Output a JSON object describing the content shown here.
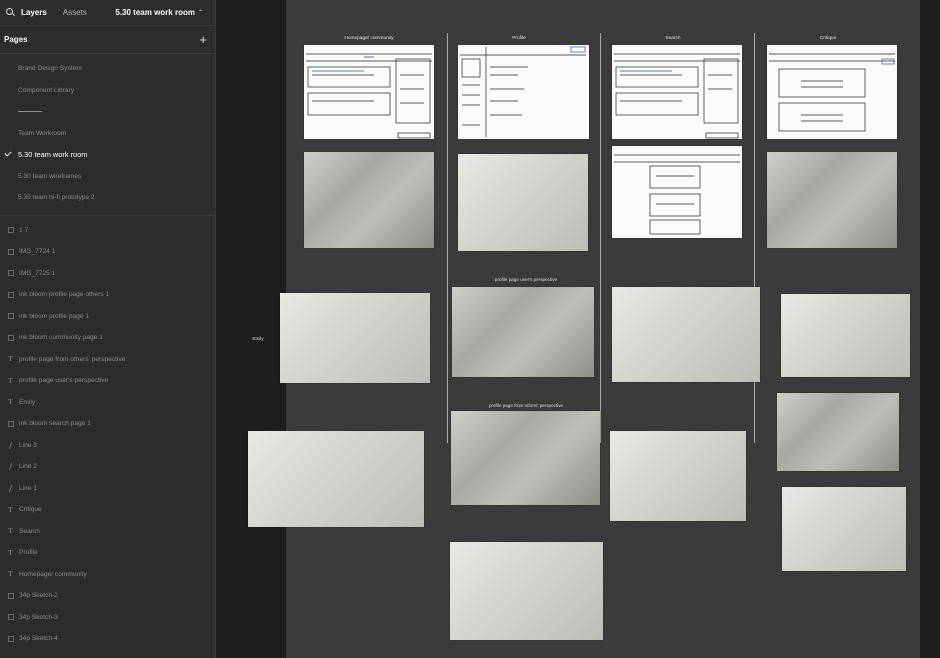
{
  "topbar": {
    "layers_tab": "Layers",
    "assets_tab": "Assets",
    "file_name": "5.30 team work room"
  },
  "pages": {
    "title": "Pages",
    "items": [
      {
        "label": "Brand Design System",
        "active": false
      },
      {
        "label": "Component Library",
        "active": false
      },
      {
        "label": "-------",
        "active": false,
        "separator": true
      },
      {
        "label": "Team Workroom",
        "active": false
      },
      {
        "label": "5.30 team work room",
        "active": true
      },
      {
        "label": "5.30 team wireframes",
        "active": false
      },
      {
        "label": "5.30 team hi-fi prototype 2",
        "active": false
      }
    ]
  },
  "layers": [
    {
      "label": "1 7",
      "icon": "frame"
    },
    {
      "label": "IMG_7724 1",
      "icon": "frame"
    },
    {
      "label": "IMG_7725 1",
      "icon": "frame"
    },
    {
      "label": "ink bloom profile page others 1",
      "icon": "frame"
    },
    {
      "label": "ink bloom profile page 1",
      "icon": "frame"
    },
    {
      "label": "ink bloom community page 1",
      "icon": "frame"
    },
    {
      "label": "profile page from others' perspective",
      "icon": "text"
    },
    {
      "label": "profile page user's perspective",
      "icon": "text"
    },
    {
      "label": "Emily",
      "icon": "text"
    },
    {
      "label": "ink bloom search page 1",
      "icon": "frame"
    },
    {
      "label": "Line 3",
      "icon": "line"
    },
    {
      "label": "Line 2",
      "icon": "line"
    },
    {
      "label": "Line 1",
      "icon": "line"
    },
    {
      "label": "Critique",
      "icon": "text"
    },
    {
      "label": "Search",
      "icon": "text"
    },
    {
      "label": "Profile",
      "icon": "text"
    },
    {
      "label": "Homepage/ community",
      "icon": "text"
    },
    {
      "label": "34p Sketch-2",
      "icon": "frame"
    },
    {
      "label": "34p Sketch-3",
      "icon": "frame"
    },
    {
      "label": "34p Sketch-4",
      "icon": "frame"
    }
  ],
  "canvas": {
    "columns": [
      "Homepage/ community",
      "Profile",
      "Search",
      "Critique"
    ],
    "side_label": "Emily",
    "captions": {
      "user_perspective": "profile page user's perspective",
      "others_perspective": "profile page from others' perspective"
    }
  }
}
